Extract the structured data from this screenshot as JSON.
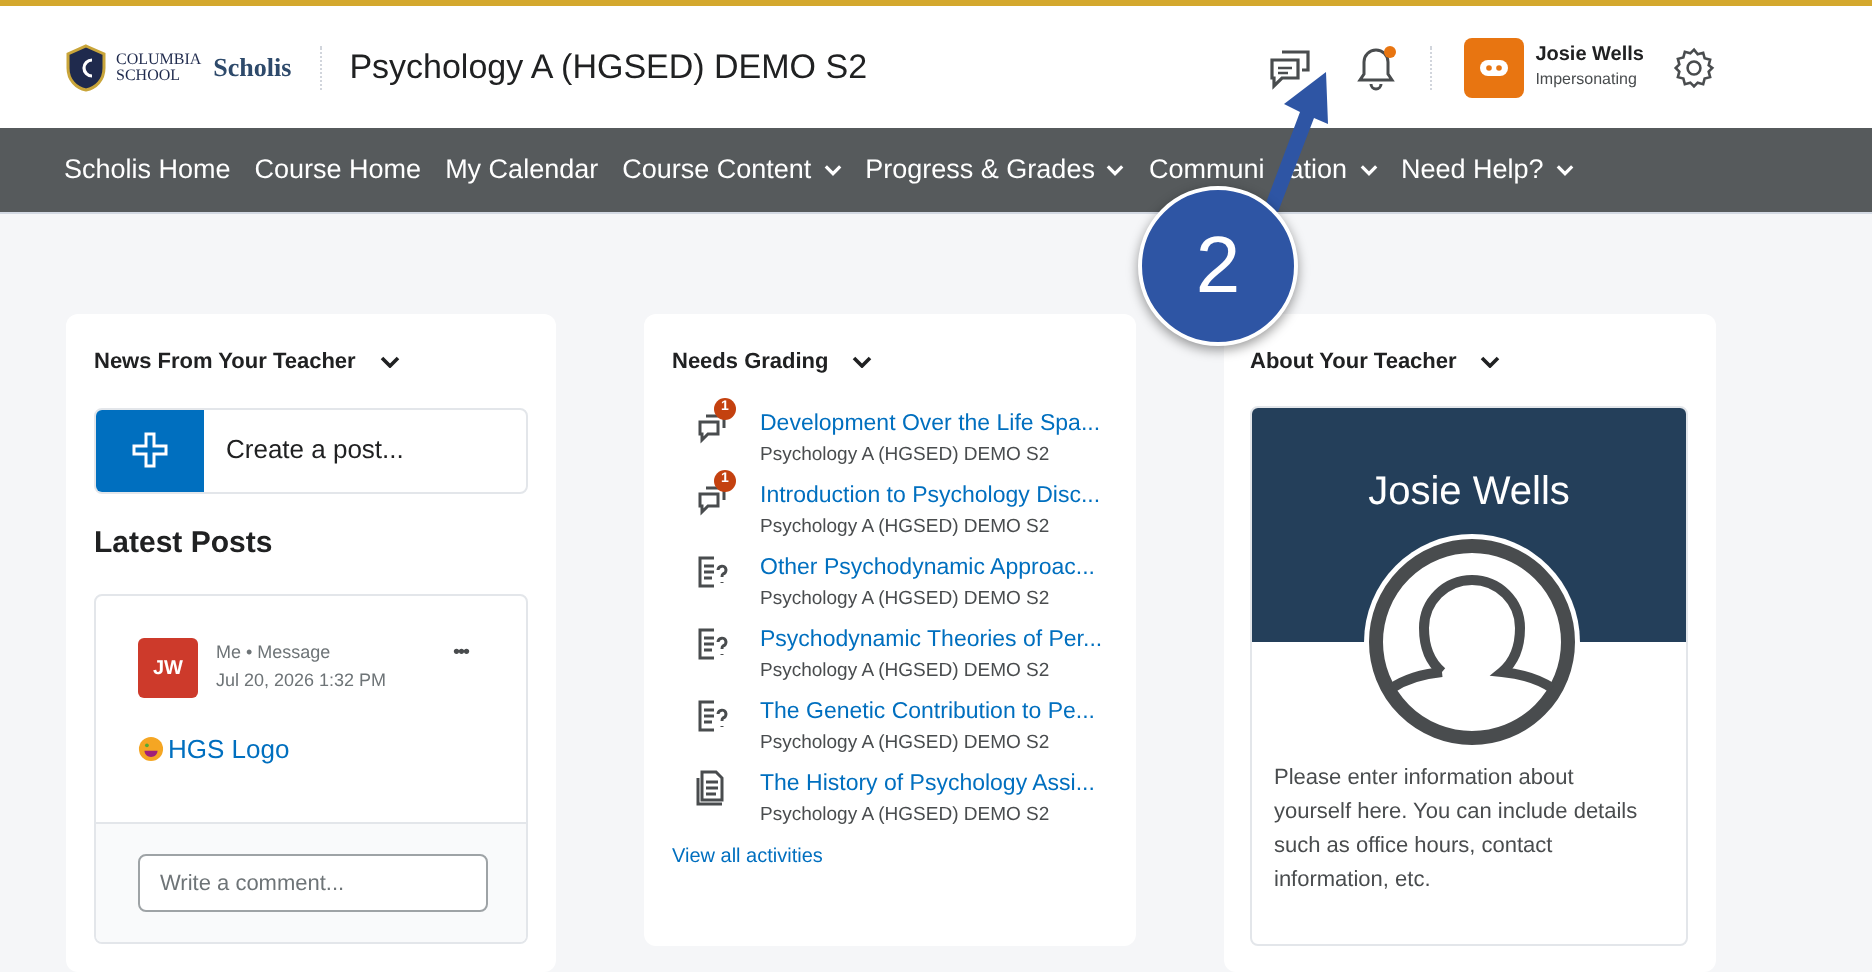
{
  "header": {
    "logo_line1": "COLUMBIA",
    "logo_line2": "SCHOOL",
    "logo_brand": "Scholis",
    "course_title": "Psychology A (HGSED) DEMO S2",
    "notification_dot": true,
    "user_name": "Josie Wells",
    "user_status": "Impersonating"
  },
  "nav": [
    {
      "label": "Scholis Home",
      "dropdown": false
    },
    {
      "label": "Course Home",
      "dropdown": false
    },
    {
      "label": "My Calendar",
      "dropdown": false
    },
    {
      "label": "Course Content",
      "dropdown": true
    },
    {
      "label": "Progress & Grades",
      "dropdown": true
    },
    {
      "label": "Communi",
      "label_after": "ation",
      "dropdown": true
    },
    {
      "label": "Need Help?",
      "dropdown": true
    }
  ],
  "callout": {
    "number": "2"
  },
  "news": {
    "title": "News From Your Teacher",
    "create_post": "Create a post...",
    "latest_title": "Latest Posts",
    "post": {
      "initials": "JW",
      "author": "Me",
      "separator": "•",
      "type": "Message",
      "date": "Jul 20, 2026 1:32 PM",
      "more": "•••",
      "link": "HGS Logo"
    },
    "comment_placeholder": "Write a comment..."
  },
  "grading": {
    "title": "Needs Grading",
    "items": [
      {
        "kind": "discussion",
        "badge": "1",
        "title": "Development Over the Life Spa...",
        "course": "Psychology A (HGSED) DEMO S2"
      },
      {
        "kind": "discussion",
        "badge": "1",
        "title": "Introduction to Psychology Disc...",
        "course": "Psychology A (HGSED) DEMO S2"
      },
      {
        "kind": "quiz",
        "title": "Other Psychodynamic Approac...",
        "course": "Psychology A (HGSED) DEMO S2"
      },
      {
        "kind": "quiz",
        "title": "Psychodynamic Theories of Per...",
        "course": "Psychology A (HGSED) DEMO S2"
      },
      {
        "kind": "quiz",
        "title": "The Genetic Contribution to Pe...",
        "course": "Psychology A (HGSED) DEMO S2"
      },
      {
        "kind": "assignment",
        "title": "The History of Psychology Assi...",
        "course": "Psychology A (HGSED) DEMO S2"
      }
    ],
    "view_all": "View all activities"
  },
  "about": {
    "title": "About Your Teacher",
    "name": "Josie Wells",
    "text": "Please enter information about yourself here. You can include details such as office hours, contact information, etc."
  }
}
